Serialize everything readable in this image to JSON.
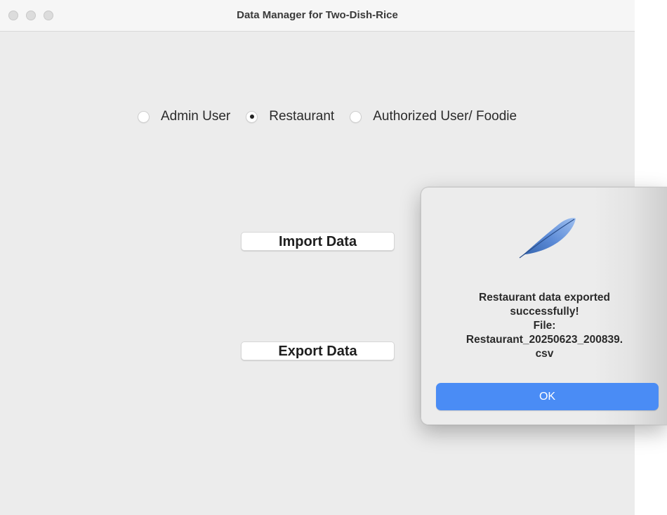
{
  "window": {
    "title": "Data Manager for Two-Dish-Rice"
  },
  "user_types": {
    "options": [
      {
        "label": "Admin User",
        "checked": false
      },
      {
        "label": "Restaurant",
        "checked": true
      },
      {
        "label": "Authorized User/ Foodie",
        "checked": false
      }
    ]
  },
  "actions": {
    "import_label": "Import Data",
    "export_label": "Export Data"
  },
  "dialog": {
    "icon": "feather-icon",
    "message_lines": [
      "Restaurant data exported",
      "successfully!",
      "File:",
      "Restaurant_20250623_200839.",
      "csv"
    ],
    "ok_label": "OK"
  },
  "colors": {
    "accent": "#4a8cf5",
    "window_bg": "#ececec"
  }
}
